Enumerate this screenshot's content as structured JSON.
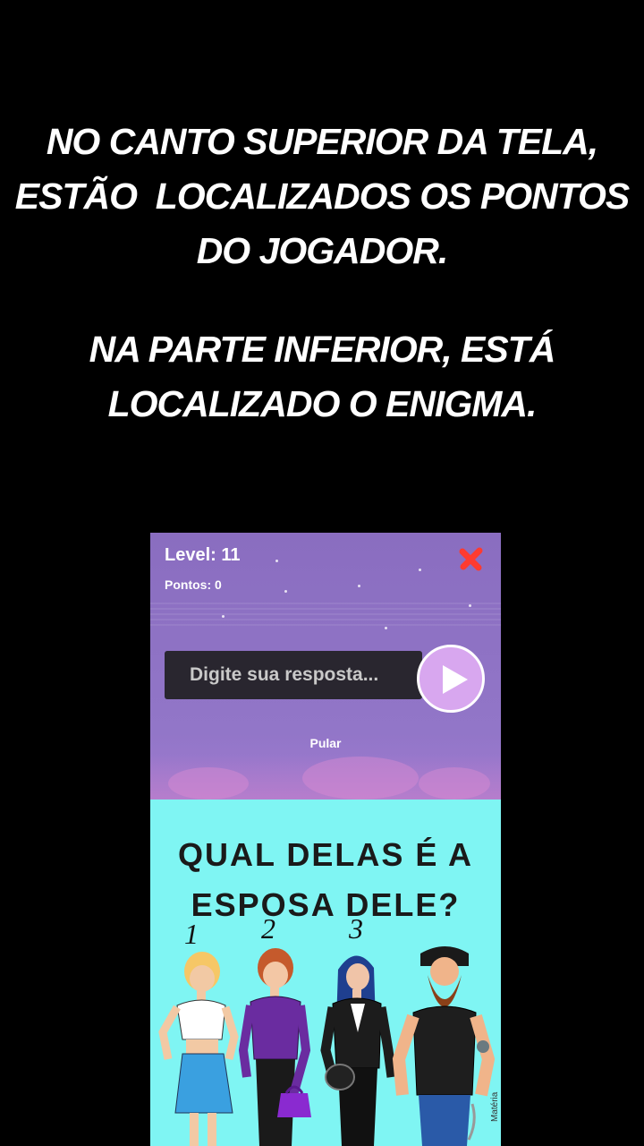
{
  "caption": {
    "top_lines": [
      "NO CANTO SUPERIOR DA TELA,",
      "ESTÃO  LOCALIZADOS OS PONTOS",
      "DO JOGADOR."
    ],
    "bottom_lines": [
      "NA PARTE INFERIOR, ESTÁ",
      "LOCALIZADO O ENIGMA."
    ]
  },
  "game": {
    "level_label": "Level: 11",
    "points_label": "Pontos: 0",
    "answer_placeholder": "Digite sua resposta...",
    "skip_label": "Pular",
    "close_icon": "close-icon",
    "play_icon": "play-icon",
    "colors": {
      "background": "#8e72c4",
      "close": "#ff3b30",
      "play": "#d8a7ef",
      "input": "#29262f"
    }
  },
  "puzzle": {
    "question_lines": [
      "QUAL DELAS É A",
      "ESPOSA DELE?"
    ],
    "numbers": [
      "1",
      "2",
      "3"
    ],
    "credit": "Matéria",
    "background": "#7ff5f3"
  }
}
